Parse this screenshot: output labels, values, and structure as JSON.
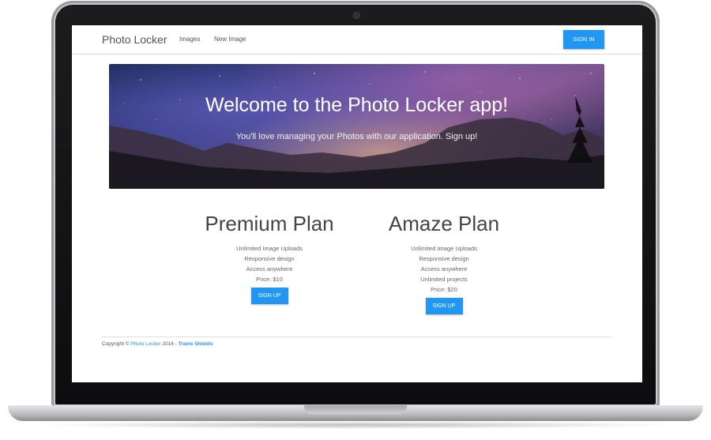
{
  "navbar": {
    "brand": "Photo Locker",
    "links": [
      "Images",
      "New Image"
    ],
    "signin_label": "SIGN IN"
  },
  "hero": {
    "title": "Welcome to the Photo Locker app!",
    "subtitle": "You'll love managing your Photos with our application. Sign up!"
  },
  "plans": [
    {
      "title": "Premium Plan",
      "features": [
        "Unlimited Image Uploads",
        "Responsive design",
        "Access anywhere",
        "Price: $10"
      ],
      "button_label": "SIGN UP"
    },
    {
      "title": "Amaze Plan",
      "features": [
        "Unlimited Image Uploads",
        "Responsive design",
        "Access anywhere",
        "Unlimited projects",
        "Price: $20"
      ],
      "button_label": "SIGN UP"
    }
  ],
  "footer": {
    "prefix": "Copyright ©",
    "brand_link": "Photo Locker",
    "year_sep": "2016 -",
    "author": "Travis Shields"
  },
  "colors": {
    "accent": "#2196f3",
    "text": "#555555"
  }
}
